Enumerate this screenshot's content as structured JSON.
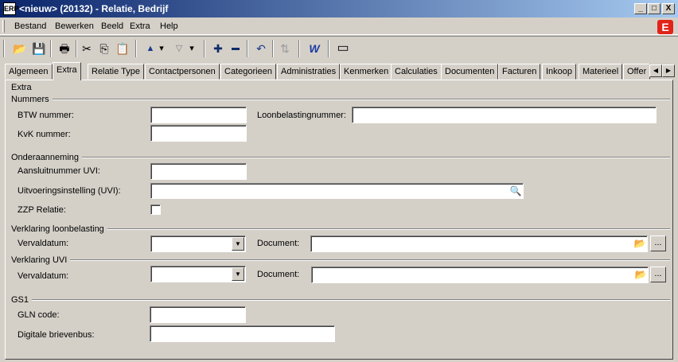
{
  "window": {
    "title": "<nieuw> (20132) - Relatie, Bedrijf",
    "app_icon": "ERP",
    "btn_min": "_",
    "btn_max": "□",
    "btn_close": "X"
  },
  "menu": {
    "items": [
      "Bestand",
      "Bewerken",
      "Beeld",
      "Extra",
      "Help"
    ],
    "logo": "E"
  },
  "toolbar": {
    "icons": [
      "open-folder-icon",
      "save-icon",
      "print-icon",
      "cut-icon",
      "copy-icon",
      "paste-icon",
      "arrow-up-icon",
      "arrow-down-icon",
      "add-icon",
      "remove-icon",
      "undo-icon",
      "refresh-icon",
      "word-icon",
      "window-icon"
    ],
    "glyphs": {
      "open": "📂",
      "save": "💾",
      "print": "🖶",
      "cut": "✂",
      "copy": "⎘",
      "paste": "📋",
      "up": "▲",
      "down": "▽",
      "dd": "▾",
      "add": "✚",
      "remove": "▬",
      "undo": "↶",
      "refresh": "⇅",
      "word": "W",
      "window": "▭"
    }
  },
  "tabs": {
    "items": [
      "Algemeen",
      "Extra",
      "Relatie Type",
      "Contactpersonen",
      "Categorieen",
      "Administraties",
      "Kenmerken",
      "Calculaties",
      "Documenten",
      "Facturen",
      "Inkoop",
      "Materieel",
      "Offer"
    ],
    "active": "Extra",
    "scroll_left": "◀",
    "scroll_right": "▶"
  },
  "panel": {
    "title": "Extra",
    "groups": {
      "nummers": "Nummers",
      "onderaanneming": "Onderaanneming",
      "verklaring_loon": "Verklaring loonbelasting",
      "verklaring_uvi": "Verklaring UVI",
      "gs1": "GS1"
    },
    "fields": {
      "btw_label": "BTW nummer:",
      "btw_value": "",
      "loonbelasting_label": "Loonbelastingnummer:",
      "loonbelasting_value": "",
      "kvk_label": "KvK nummer:",
      "kvk_value": "",
      "aansluit_label": "Aansluitnummer UVI:",
      "aansluit_value": "",
      "uitvoering_label": "Uitvoeringsinstelling (UVI):",
      "uitvoering_value": "",
      "zzp_label": "ZZP Relatie:",
      "vervaldatum_label": "Vervaldatum:",
      "document_label": "Document:",
      "gln_label": "GLN code:",
      "gln_value": "",
      "brievenbus_label": "Digitale brievenbus:",
      "brievenbus_value": "",
      "browse": "...",
      "folder_glyph": "📂",
      "search_glyph": "🔍",
      "dropdown_glyph": "▼"
    }
  }
}
